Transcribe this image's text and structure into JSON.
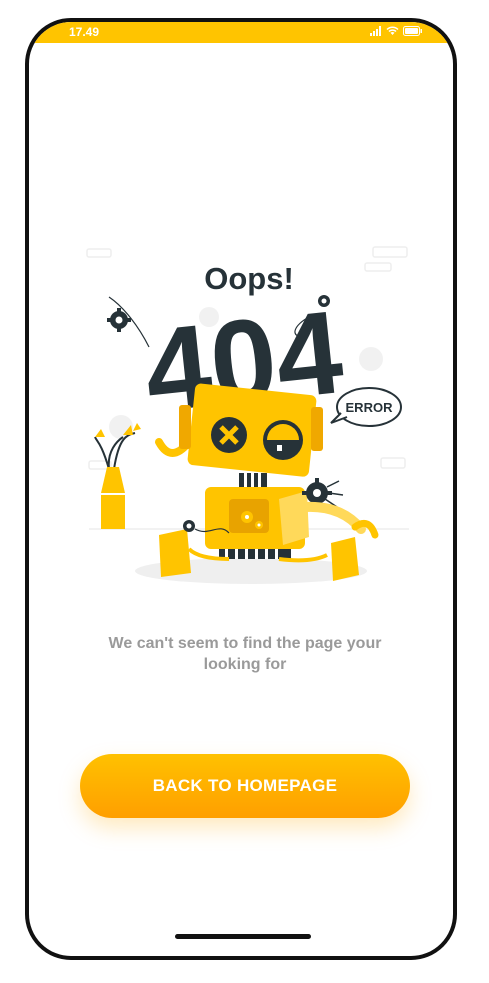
{
  "status_bar": {
    "time": "17.49",
    "icons": [
      "signal-icon",
      "wifi-icon",
      "battery-icon"
    ]
  },
  "illustration": {
    "title": "Oops!",
    "code": "404",
    "badge": "ERROR"
  },
  "message": "We can't seem to find the page your looking for",
  "home_button": {
    "label": "BACK TO HOMEPAGE"
  },
  "colors": {
    "accent": "#FFC400",
    "button_top": "#FFC100",
    "button_bottom": "#FF9F00",
    "dark": "#263238",
    "message": "#9a9a9a"
  }
}
